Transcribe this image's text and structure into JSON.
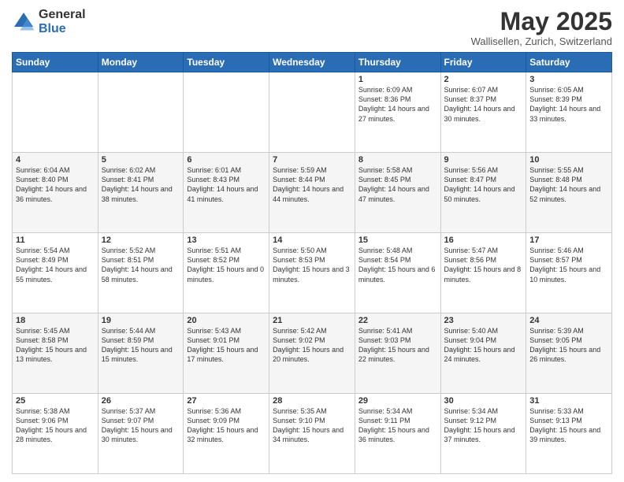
{
  "logo": {
    "general": "General",
    "blue": "Blue"
  },
  "title": "May 2025",
  "subtitle": "Wallisellen, Zurich, Switzerland",
  "days_of_week": [
    "Sunday",
    "Monday",
    "Tuesday",
    "Wednesday",
    "Thursday",
    "Friday",
    "Saturday"
  ],
  "weeks": [
    [
      {
        "day": "",
        "info": ""
      },
      {
        "day": "",
        "info": ""
      },
      {
        "day": "",
        "info": ""
      },
      {
        "day": "",
        "info": ""
      },
      {
        "day": "1",
        "info": "Sunrise: 6:09 AM\nSunset: 8:36 PM\nDaylight: 14 hours\nand 27 minutes."
      },
      {
        "day": "2",
        "info": "Sunrise: 6:07 AM\nSunset: 8:37 PM\nDaylight: 14 hours\nand 30 minutes."
      },
      {
        "day": "3",
        "info": "Sunrise: 6:05 AM\nSunset: 8:39 PM\nDaylight: 14 hours\nand 33 minutes."
      }
    ],
    [
      {
        "day": "4",
        "info": "Sunrise: 6:04 AM\nSunset: 8:40 PM\nDaylight: 14 hours\nand 36 minutes."
      },
      {
        "day": "5",
        "info": "Sunrise: 6:02 AM\nSunset: 8:41 PM\nDaylight: 14 hours\nand 38 minutes."
      },
      {
        "day": "6",
        "info": "Sunrise: 6:01 AM\nSunset: 8:43 PM\nDaylight: 14 hours\nand 41 minutes."
      },
      {
        "day": "7",
        "info": "Sunrise: 5:59 AM\nSunset: 8:44 PM\nDaylight: 14 hours\nand 44 minutes."
      },
      {
        "day": "8",
        "info": "Sunrise: 5:58 AM\nSunset: 8:45 PM\nDaylight: 14 hours\nand 47 minutes."
      },
      {
        "day": "9",
        "info": "Sunrise: 5:56 AM\nSunset: 8:47 PM\nDaylight: 14 hours\nand 50 minutes."
      },
      {
        "day": "10",
        "info": "Sunrise: 5:55 AM\nSunset: 8:48 PM\nDaylight: 14 hours\nand 52 minutes."
      }
    ],
    [
      {
        "day": "11",
        "info": "Sunrise: 5:54 AM\nSunset: 8:49 PM\nDaylight: 14 hours\nand 55 minutes."
      },
      {
        "day": "12",
        "info": "Sunrise: 5:52 AM\nSunset: 8:51 PM\nDaylight: 14 hours\nand 58 minutes."
      },
      {
        "day": "13",
        "info": "Sunrise: 5:51 AM\nSunset: 8:52 PM\nDaylight: 15 hours\nand 0 minutes."
      },
      {
        "day": "14",
        "info": "Sunrise: 5:50 AM\nSunset: 8:53 PM\nDaylight: 15 hours\nand 3 minutes."
      },
      {
        "day": "15",
        "info": "Sunrise: 5:48 AM\nSunset: 8:54 PM\nDaylight: 15 hours\nand 6 minutes."
      },
      {
        "day": "16",
        "info": "Sunrise: 5:47 AM\nSunset: 8:56 PM\nDaylight: 15 hours\nand 8 minutes."
      },
      {
        "day": "17",
        "info": "Sunrise: 5:46 AM\nSunset: 8:57 PM\nDaylight: 15 hours\nand 10 minutes."
      }
    ],
    [
      {
        "day": "18",
        "info": "Sunrise: 5:45 AM\nSunset: 8:58 PM\nDaylight: 15 hours\nand 13 minutes."
      },
      {
        "day": "19",
        "info": "Sunrise: 5:44 AM\nSunset: 8:59 PM\nDaylight: 15 hours\nand 15 minutes."
      },
      {
        "day": "20",
        "info": "Sunrise: 5:43 AM\nSunset: 9:01 PM\nDaylight: 15 hours\nand 17 minutes."
      },
      {
        "day": "21",
        "info": "Sunrise: 5:42 AM\nSunset: 9:02 PM\nDaylight: 15 hours\nand 20 minutes."
      },
      {
        "day": "22",
        "info": "Sunrise: 5:41 AM\nSunset: 9:03 PM\nDaylight: 15 hours\nand 22 minutes."
      },
      {
        "day": "23",
        "info": "Sunrise: 5:40 AM\nSunset: 9:04 PM\nDaylight: 15 hours\nand 24 minutes."
      },
      {
        "day": "24",
        "info": "Sunrise: 5:39 AM\nSunset: 9:05 PM\nDaylight: 15 hours\nand 26 minutes."
      }
    ],
    [
      {
        "day": "25",
        "info": "Sunrise: 5:38 AM\nSunset: 9:06 PM\nDaylight: 15 hours\nand 28 minutes."
      },
      {
        "day": "26",
        "info": "Sunrise: 5:37 AM\nSunset: 9:07 PM\nDaylight: 15 hours\nand 30 minutes."
      },
      {
        "day": "27",
        "info": "Sunrise: 5:36 AM\nSunset: 9:09 PM\nDaylight: 15 hours\nand 32 minutes."
      },
      {
        "day": "28",
        "info": "Sunrise: 5:35 AM\nSunset: 9:10 PM\nDaylight: 15 hours\nand 34 minutes."
      },
      {
        "day": "29",
        "info": "Sunrise: 5:34 AM\nSunset: 9:11 PM\nDaylight: 15 hours\nand 36 minutes."
      },
      {
        "day": "30",
        "info": "Sunrise: 5:34 AM\nSunset: 9:12 PM\nDaylight: 15 hours\nand 37 minutes."
      },
      {
        "day": "31",
        "info": "Sunrise: 5:33 AM\nSunset: 9:13 PM\nDaylight: 15 hours\nand 39 minutes."
      }
    ]
  ]
}
